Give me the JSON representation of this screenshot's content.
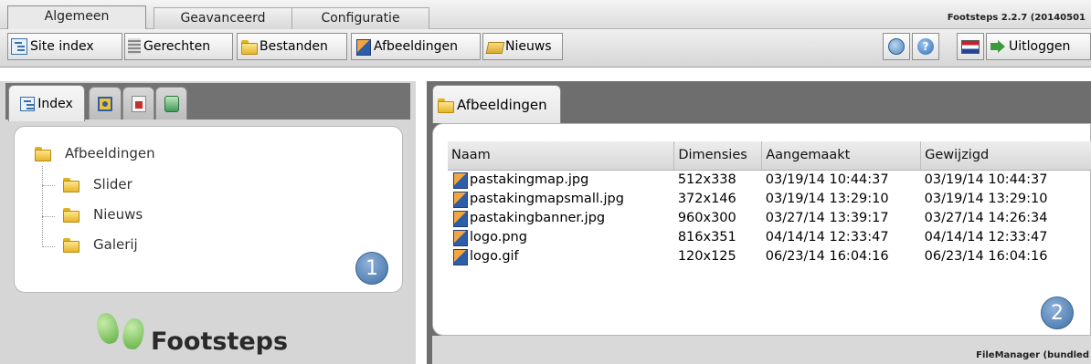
{
  "top_tabs": [
    {
      "label": "Algemeen",
      "active": true
    },
    {
      "label": "Geavanceerd",
      "active": false
    },
    {
      "label": "Configuratie",
      "active": false
    }
  ],
  "version": "Footsteps 2.2.7 (20140501",
  "toolbar": {
    "buttons": [
      {
        "label": "Site index",
        "icon": "site-index-icon"
      },
      {
        "label": "Gerechten",
        "icon": "menu-list-icon"
      },
      {
        "label": "Bestanden",
        "icon": "folder-icon"
      },
      {
        "label": "Afbeeldingen",
        "icon": "image-icon"
      },
      {
        "label": "Nieuws",
        "icon": "news-icon"
      }
    ],
    "logout_label": "Uitloggen",
    "right_icons": [
      "globe-icon",
      "help-icon",
      "flag-nl-icon"
    ]
  },
  "left_panel": {
    "tabs": [
      {
        "label": "Index",
        "icon": "index-icon"
      },
      {
        "label": "",
        "icon": "settings-icon"
      },
      {
        "label": "",
        "icon": "bookmark-icon"
      },
      {
        "label": "",
        "icon": "recycle-bin-icon"
      }
    ],
    "tree": {
      "root": "Afbeeldingen",
      "children": [
        "Slider",
        "Nieuws",
        "Galerij"
      ]
    },
    "badge": "1",
    "logo_text": "Footsteps"
  },
  "right_panel": {
    "tab_label": "Afbeeldingen",
    "columns": [
      "Naam",
      "Dimensies",
      "Aangemaakt",
      "Gewijzigd"
    ],
    "files": [
      {
        "name": "pastakingmap.jpg",
        "dims": "512x338",
        "created": "03/19/14 10:44:37",
        "modified": "03/19/14 10:44:37"
      },
      {
        "name": "pastakingmapsmall.jpg",
        "dims": "372x146",
        "created": "03/19/14 13:29:10",
        "modified": "03/19/14 13:29:10"
      },
      {
        "name": "pastakingbanner.jpg",
        "dims": "960x300",
        "created": "03/27/14 13:39:17",
        "modified": "03/27/14 14:26:34"
      },
      {
        "name": "logo.png",
        "dims": "816x351",
        "created": "04/14/14 12:33:47",
        "modified": "04/14/14 12:33:47"
      },
      {
        "name": "logo.gif",
        "dims": "120x125",
        "created": "06/23/14 16:04:16",
        "modified": "06/23/14 16:04:16"
      }
    ],
    "badge": "2",
    "footer_label": "FileManager (bundled"
  }
}
